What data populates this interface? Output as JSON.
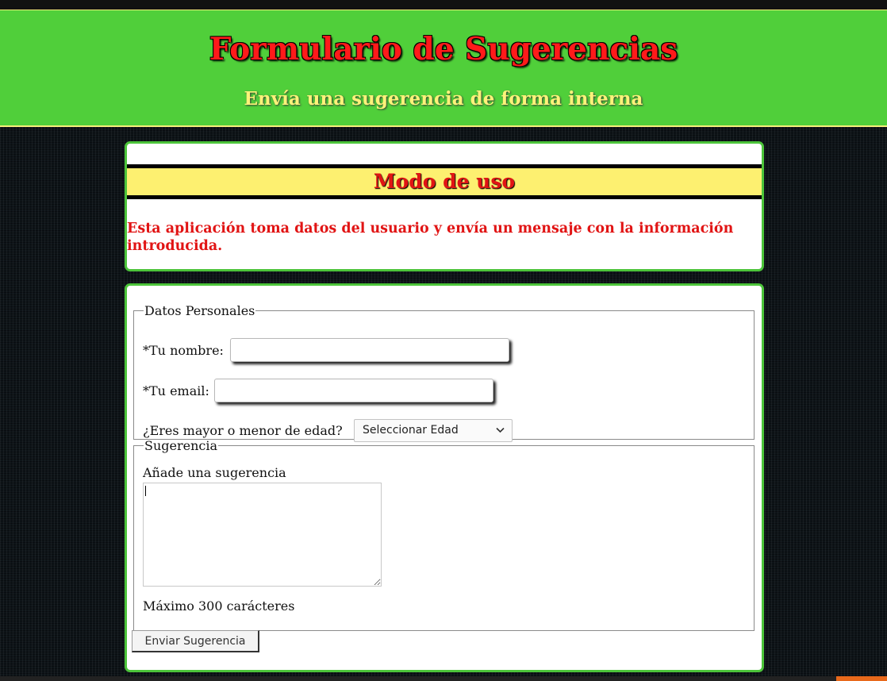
{
  "header": {
    "title": "Formulario de Sugerencias",
    "subtitle": "Envía una sugerencia de forma interna"
  },
  "usage": {
    "title": "Modo de uso",
    "text": "Esta aplicación toma datos del usuario y envía un mensaje con la información introducida."
  },
  "personal": {
    "legend": "Datos Personales",
    "name_label": "*Tu nombre:",
    "name_value": "",
    "email_label": "*Tu email:",
    "email_value": "",
    "age_label": "¿Eres mayor o menor de edad?",
    "age_selected": "Seleccionar Edad"
  },
  "suggestion": {
    "legend": "Sugerencia",
    "label": "Añade una sugerencia",
    "value": "",
    "limit_note": "Máximo 300 carácteres"
  },
  "submit": {
    "label": "Enviar Sugerencia"
  },
  "colors": {
    "banner_green": "#50cf3a",
    "title_red": "#ff1a1a",
    "subtitle_yellow": "#fff27a",
    "usage_yellow": "#fdf070",
    "card_border": "#4cc43a"
  },
  "icons": {
    "select_arrow": "chevron-down-icon"
  }
}
